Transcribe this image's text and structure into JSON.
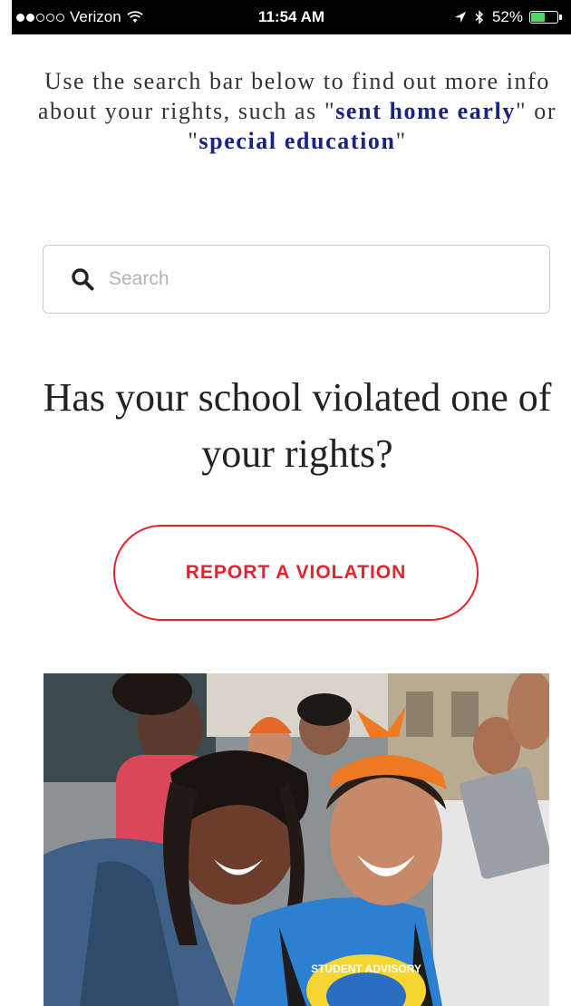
{
  "status_bar": {
    "carrier": "Verizon",
    "time": "11:54 AM",
    "battery_percent": "52%",
    "battery_level": 0.52,
    "signal_bars": 2,
    "icons": [
      "wifi-icon",
      "location-arrow-icon",
      "bluetooth-icon",
      "battery-icon"
    ]
  },
  "intro": {
    "line_before": "Use the search bar below to find out more info about your rights, such as ",
    "quote_open_1": "\"",
    "keyword_1": "sent home early",
    "quote_close_1": "\"",
    "connector": " or ",
    "quote_open_2": "\"",
    "keyword_2": "special education",
    "quote_close_2": "\""
  },
  "search": {
    "placeholder": "Search",
    "value": "",
    "icon": "search-icon"
  },
  "question": {
    "heading": "Has your school violated one of your rights?"
  },
  "cta": {
    "label": "REPORT A VIOLATION"
  },
  "photo": {
    "shirt_text": "STUDENT ADVISORY"
  },
  "colors": {
    "accent_red": "#e0252f",
    "keyword_navy": "#1a237e",
    "battery_green": "#4cd964"
  }
}
